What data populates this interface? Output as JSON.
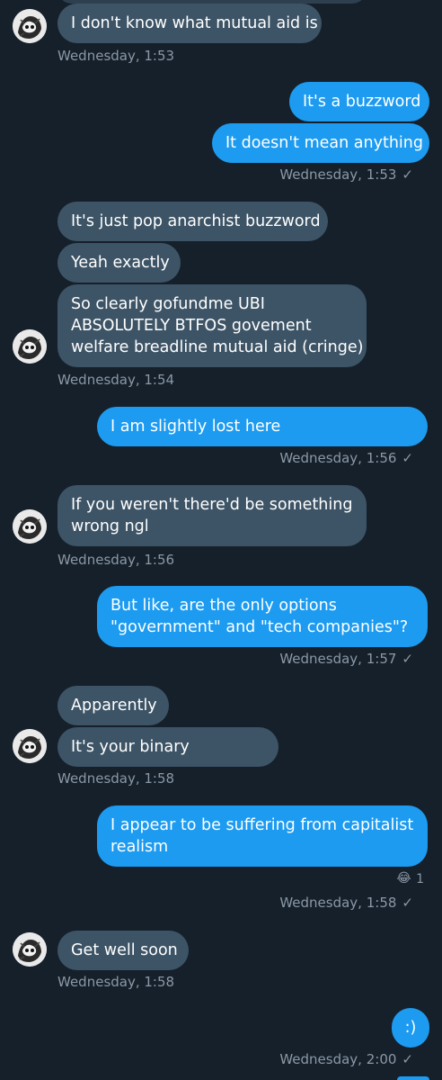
{
  "messages": [
    {
      "side": "in",
      "text": "I don't know what mutual aid is"
    },
    {
      "ts": "Wednesday, 1:53"
    },
    {
      "side": "out",
      "text": "It's a buzzword"
    },
    {
      "side": "out",
      "text": "It doesn't mean anything"
    },
    {
      "ts": "Wednesday, 1:53"
    },
    {
      "side": "in",
      "text": "It's just pop anarchist buzzword"
    },
    {
      "side": "in",
      "text": "Yeah exactly"
    },
    {
      "side": "in",
      "lines": [
        "So clearly gofundme UBI",
        "ABSOLUTELY BTFOS govement",
        "welfare breadline mutual aid (cringe)"
      ]
    },
    {
      "ts": "Wednesday, 1:54"
    },
    {
      "side": "out",
      "text": "I am slightly lost here"
    },
    {
      "ts": "Wednesday, 1:56"
    },
    {
      "side": "in",
      "lines": [
        "If you weren't there'd be something",
        "wrong ngl"
      ]
    },
    {
      "ts": "Wednesday, 1:56"
    },
    {
      "side": "out",
      "lines": [
        "But like, are the only options",
        "\"government\" and \"tech companies\"?"
      ]
    },
    {
      "ts": "Wednesday, 1:57"
    },
    {
      "side": "in",
      "text": "Apparently"
    },
    {
      "side": "in",
      "text": "It's your binary"
    },
    {
      "ts": "Wednesday, 1:58"
    },
    {
      "side": "out",
      "lines": [
        "I appear to be suffering from capitalist",
        "realism"
      ]
    },
    {
      "reaction": {
        "emoji": "😂",
        "count": "1"
      }
    },
    {
      "ts": "Wednesday, 1:58"
    },
    {
      "side": "in",
      "text": "Get well soon"
    },
    {
      "ts": "Wednesday, 1:58"
    },
    {
      "side": "out",
      "text": ":)"
    },
    {
      "ts": "Wednesday, 2:00"
    }
  ],
  "read_check": "✓",
  "avatar_icon": "sketch-portrait-avatar",
  "colors": {
    "background": "#15202b",
    "incoming_bubble": "#3d5466",
    "outgoing_bubble": "#1d9bf0",
    "timestamp": "#8b98a5"
  }
}
